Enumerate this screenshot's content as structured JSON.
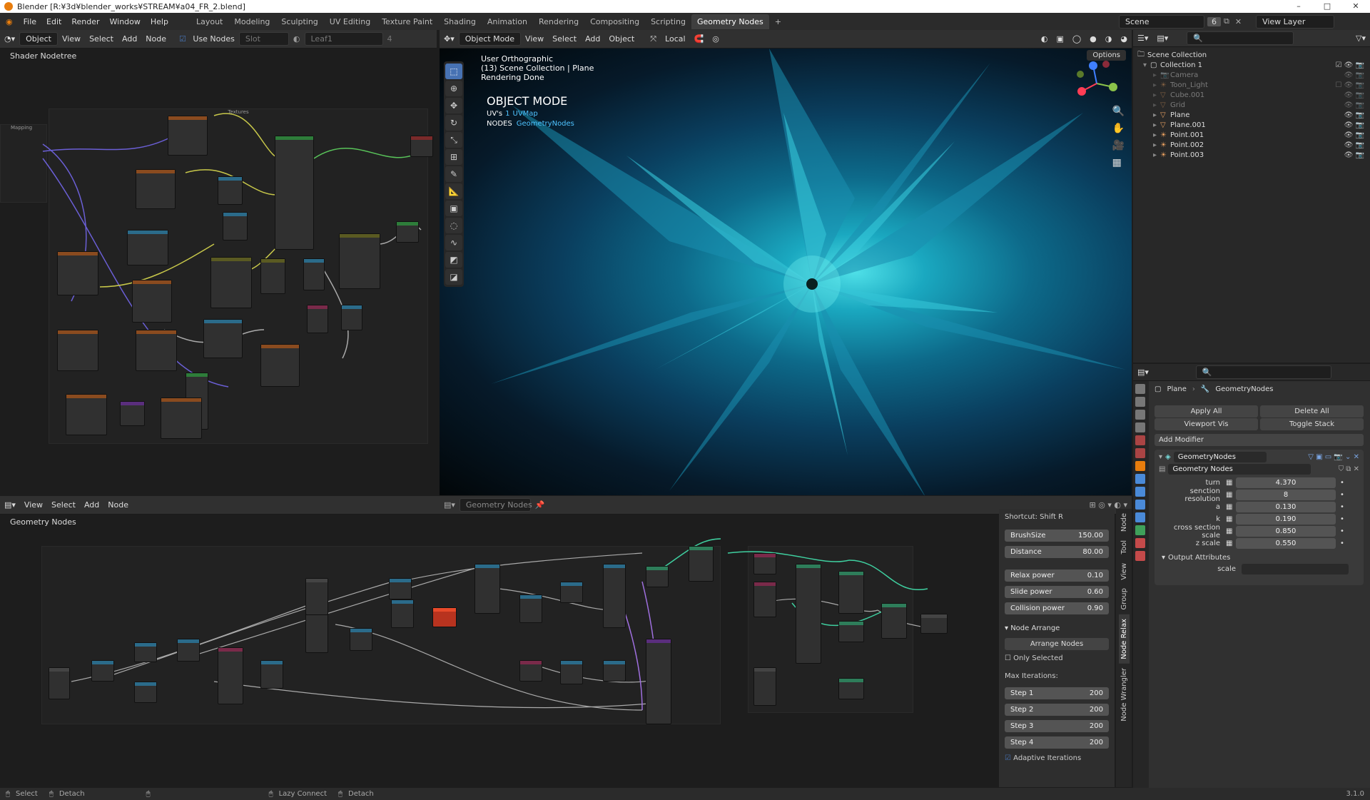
{
  "title_bar": {
    "title": "Blender [R:¥3d¥blender_works¥STREAM¥a04_FR_2.blend]"
  },
  "menu": [
    "File",
    "Edit",
    "Render",
    "Window",
    "Help"
  ],
  "workspaces": [
    "Layout",
    "Modeling",
    "Sculpting",
    "UV Editing",
    "Texture Paint",
    "Shading",
    "Animation",
    "Rendering",
    "Compositing",
    "Scripting",
    "Geometry Nodes"
  ],
  "active_workspace": "Geometry Nodes",
  "scene": {
    "name": "Scene",
    "count": "6",
    "view_layer": "View Layer"
  },
  "shader_editor": {
    "mode": "Object",
    "menus": [
      "View",
      "Select",
      "Add",
      "Node"
    ],
    "use_nodes": "Use Nodes",
    "slot": "Slot",
    "material": "Leaf1",
    "material_users": "4",
    "breadcrumb": "Shader Nodetree",
    "frame1": "Textures",
    "frame2": "Mapping"
  },
  "viewport": {
    "mode": "Object Mode",
    "menus": [
      "View",
      "Select",
      "Add",
      "Object"
    ],
    "orientation": "Local",
    "options": "Options",
    "info1": "User Orthographic",
    "info2": "(13) Scene Collection | Plane",
    "info3": "Rendering Done",
    "heading": "OBJECT MODE",
    "uvs_label": "UV's",
    "uvs_count": "1",
    "uvs_name": "UVMap",
    "nodes_label": "NODES",
    "nodes_name": "GeometryNodes"
  },
  "outliner": {
    "root": "Scene Collection",
    "items": [
      {
        "name": "Collection 1",
        "icon": "collection-icon"
      },
      {
        "name": "Camera",
        "icon": "camera-icon"
      },
      {
        "name": "Toon_Light",
        "icon": "light-icon"
      },
      {
        "name": "Cube.001",
        "icon": "mesh-icon"
      },
      {
        "name": "Grid",
        "icon": "mesh-icon"
      },
      {
        "name": "Plane",
        "icon": "mesh-icon"
      },
      {
        "name": "Plane.001",
        "icon": "mesh-icon"
      },
      {
        "name": "Point.001",
        "icon": "light-icon"
      },
      {
        "name": "Point.002",
        "icon": "light-icon"
      },
      {
        "name": "Point.003",
        "icon": "light-icon"
      }
    ]
  },
  "properties": {
    "breadcrumb_object": "Plane",
    "breadcrumb_mod": "GeometryNodes",
    "apply_all": "Apply All",
    "delete_all": "Delete All",
    "viewport_vis": "Viewport Vis",
    "toggle_stack": "Toggle Stack",
    "add_modifier": "Add Modifier",
    "modifier_name": "GeometryNodes",
    "node_group": "Geometry Nodes",
    "inputs": [
      {
        "label": "turn",
        "value": "4.370"
      },
      {
        "label": "senction resolution",
        "value": "8"
      },
      {
        "label": "a",
        "value": "0.130"
      },
      {
        "label": "k",
        "value": "0.190"
      },
      {
        "label": "cross section scale",
        "value": "0.850"
      },
      {
        "label": "z scale",
        "value": "0.550"
      }
    ],
    "output_attributes": "Output Attributes",
    "scale_label": "scale"
  },
  "geo_editor": {
    "menus": [
      "View",
      "Select",
      "Add",
      "Node"
    ],
    "tree": "Geometry Nodes",
    "breadcrumb": "Geometry Nodes"
  },
  "npanel": {
    "shortcut": "Shortcut: Shift R",
    "brush_size_label": "BrushSize",
    "brush_size": "150.00",
    "distance_label": "Distance",
    "distance": "80.00",
    "relax_label": "Relax power",
    "relax": "0.10",
    "slide_label": "Slide power",
    "slide": "0.60",
    "collision_label": "Collision power",
    "collision": "0.90",
    "arrange_header": "Node Arrange",
    "arrange_btn": "Arrange Nodes",
    "only_selected": "Only Selected",
    "max_iter": "Max Iterations:",
    "steps": [
      {
        "label": "Step 1",
        "value": "200"
      },
      {
        "label": "Step 2",
        "value": "200"
      },
      {
        "label": "Step 3",
        "value": "200"
      },
      {
        "label": "Step 4",
        "value": "200"
      }
    ],
    "adaptive": "Adaptive Iterations",
    "tabs": [
      "Node",
      "Tool",
      "View",
      "Group",
      "Node Relax",
      "Node Wrangler"
    ]
  },
  "statusbar": {
    "select": "Select",
    "detach": "Detach",
    "lazy_connect": "Lazy Connect",
    "detach2": "Detach",
    "version": "3.1.0"
  }
}
